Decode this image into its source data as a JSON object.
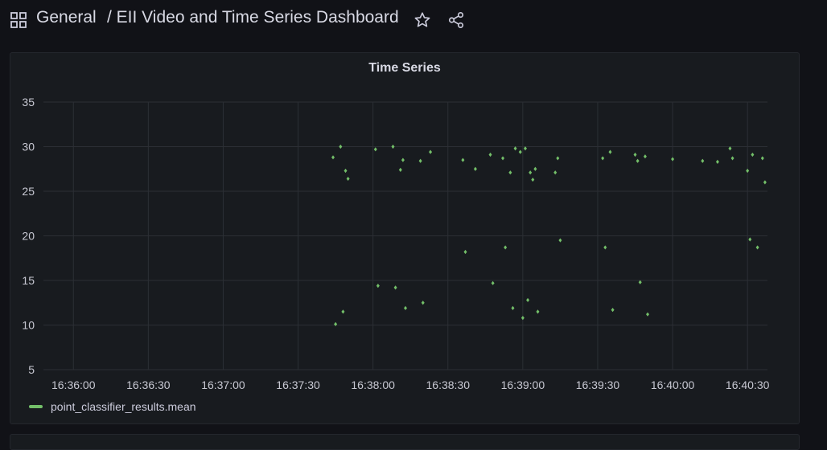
{
  "header": {
    "breadcrumb_root": "General",
    "breadcrumb_title": "/ EII Video and Time Series Dashboard",
    "icons": [
      "apps-icon",
      "star-icon",
      "share-icon"
    ]
  },
  "panel": {
    "title": "Time Series"
  },
  "chart_data": {
    "type": "scatter",
    "title": "Time Series",
    "ylim": [
      5,
      35
    ],
    "y_ticks": [
      35,
      30,
      25,
      20,
      15,
      10,
      5
    ],
    "x_range": [
      "16:35:48",
      "16:40:38"
    ],
    "x_ticks": [
      "16:36:00",
      "16:36:30",
      "16:37:00",
      "16:37:30",
      "16:38:00",
      "16:38:30",
      "16:39:00",
      "16:39:30",
      "16:40:00",
      "16:40:30"
    ],
    "grid": true,
    "legend_position": "bottom-left",
    "series": [
      {
        "name": "point_classifier_results.mean",
        "color": "#73bf69",
        "points": [
          {
            "x": "16:37:44",
            "y": 28.8
          },
          {
            "x": "16:37:45",
            "y": 10.1
          },
          {
            "x": "16:37:47",
            "y": 30.0
          },
          {
            "x": "16:37:48",
            "y": 11.5
          },
          {
            "x": "16:37:49",
            "y": 27.3
          },
          {
            "x": "16:37:50",
            "y": 26.4
          },
          {
            "x": "16:38:01",
            "y": 29.7
          },
          {
            "x": "16:38:02",
            "y": 14.4
          },
          {
            "x": "16:38:08",
            "y": 30.0
          },
          {
            "x": "16:38:09",
            "y": 14.2
          },
          {
            "x": "16:38:11",
            "y": 27.4
          },
          {
            "x": "16:38:12",
            "y": 28.5
          },
          {
            "x": "16:38:13",
            "y": 11.9
          },
          {
            "x": "16:38:19",
            "y": 28.4
          },
          {
            "x": "16:38:20",
            "y": 12.5
          },
          {
            "x": "16:38:23",
            "y": 29.4
          },
          {
            "x": "16:38:36",
            "y": 28.5
          },
          {
            "x": "16:38:37",
            "y": 18.2
          },
          {
            "x": "16:38:41",
            "y": 27.5
          },
          {
            "x": "16:38:47",
            "y": 29.1
          },
          {
            "x": "16:38:48",
            "y": 14.7
          },
          {
            "x": "16:38:52",
            "y": 28.7
          },
          {
            "x": "16:38:53",
            "y": 18.7
          },
          {
            "x": "16:38:55",
            "y": 27.1
          },
          {
            "x": "16:38:56",
            "y": 11.9
          },
          {
            "x": "16:38:57",
            "y": 29.8
          },
          {
            "x": "16:38:59",
            "y": 29.4
          },
          {
            "x": "16:39:00",
            "y": 10.8
          },
          {
            "x": "16:39:01",
            "y": 29.8
          },
          {
            "x": "16:39:02",
            "y": 12.8
          },
          {
            "x": "16:39:03",
            "y": 27.1
          },
          {
            "x": "16:39:04",
            "y": 26.3
          },
          {
            "x": "16:39:05",
            "y": 27.5
          },
          {
            "x": "16:39:06",
            "y": 11.5
          },
          {
            "x": "16:39:13",
            "y": 27.1
          },
          {
            "x": "16:39:14",
            "y": 28.7
          },
          {
            "x": "16:39:15",
            "y": 19.5
          },
          {
            "x": "16:39:32",
            "y": 28.7
          },
          {
            "x": "16:39:33",
            "y": 18.7
          },
          {
            "x": "16:39:35",
            "y": 29.4
          },
          {
            "x": "16:39:36",
            "y": 11.7
          },
          {
            "x": "16:39:45",
            "y": 29.1
          },
          {
            "x": "16:39:46",
            "y": 28.4
          },
          {
            "x": "16:39:47",
            "y": 14.8
          },
          {
            "x": "16:39:49",
            "y": 28.9
          },
          {
            "x": "16:39:50",
            "y": 11.2
          },
          {
            "x": "16:40:00",
            "y": 28.6
          },
          {
            "x": "16:40:12",
            "y": 28.4
          },
          {
            "x": "16:40:18",
            "y": 28.3
          },
          {
            "x": "16:40:23",
            "y": 29.8
          },
          {
            "x": "16:40:24",
            "y": 28.7
          },
          {
            "x": "16:40:30",
            "y": 27.3
          },
          {
            "x": "16:40:31",
            "y": 19.6
          },
          {
            "x": "16:40:32",
            "y": 29.1
          },
          {
            "x": "16:40:34",
            "y": 18.7
          },
          {
            "x": "16:40:36",
            "y": 28.7
          },
          {
            "x": "16:40:37",
            "y": 26.0
          }
        ]
      }
    ]
  },
  "legend": {
    "label": "point_classifier_results.mean",
    "color": "#73bf69"
  }
}
